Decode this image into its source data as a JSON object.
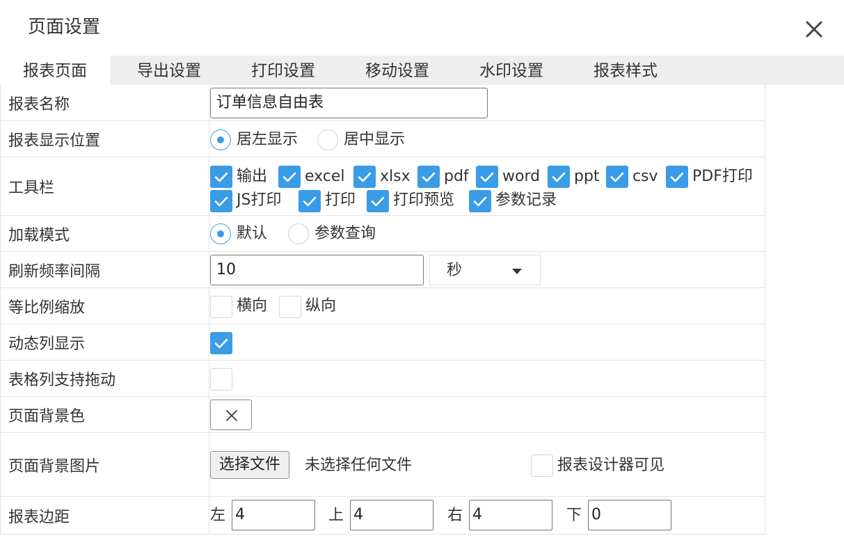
{
  "dialog": {
    "title": "页面设置",
    "close_icon": "close-icon"
  },
  "tabs": [
    "报表页面",
    "导出设置",
    "打印设置",
    "移动设置",
    "水印设置",
    "报表样式"
  ],
  "active_tab": 0,
  "accent_color": "#3a9ce6",
  "form": {
    "report_name": {
      "label": "报表名称",
      "value": "订单信息自由表"
    },
    "display_position": {
      "label": "报表显示位置",
      "options": [
        "居左显示",
        "居中显示"
      ],
      "selected": 0
    },
    "toolbar": {
      "label": "工具栏",
      "items": [
        {
          "label": "输出",
          "checked": true
        },
        {
          "label": "excel",
          "checked": true
        },
        {
          "label": "xlsx",
          "checked": true
        },
        {
          "label": "pdf",
          "checked": true
        },
        {
          "label": "word",
          "checked": true
        },
        {
          "label": "ppt",
          "checked": true
        },
        {
          "label": "csv",
          "checked": true
        },
        {
          "label": "PDF打印",
          "checked": true
        },
        {
          "label": "JS打印",
          "checked": true
        },
        {
          "label": "打印",
          "checked": true
        },
        {
          "label": "打印预览",
          "checked": true
        },
        {
          "label": "参数记录",
          "checked": true
        }
      ]
    },
    "load_mode": {
      "label": "加载模式",
      "options": [
        "默认",
        "参数查询"
      ],
      "selected": 0
    },
    "refresh_interval": {
      "label": "刷新频率间隔",
      "value": "10",
      "unit": "秒"
    },
    "proportional_scale": {
      "label": "等比例缩放",
      "options": [
        {
          "label": "横向",
          "checked": false
        },
        {
          "label": "纵向",
          "checked": false
        }
      ]
    },
    "dynamic_columns": {
      "label": "动态列显示",
      "checked": true
    },
    "column_drag": {
      "label": "表格列支持拖动",
      "checked": false
    },
    "bg_color": {
      "label": "页面背景色",
      "icon": "clear-color-icon"
    },
    "bg_image": {
      "label": "页面背景图片",
      "button": "选择文件",
      "status": "未选择任何文件",
      "designer_visible": {
        "label": "报表设计器可见",
        "checked": false
      }
    },
    "margins": {
      "label": "报表边距",
      "left": {
        "label": "左",
        "value": "4"
      },
      "top": {
        "label": "上",
        "value": "4"
      },
      "right": {
        "label": "右",
        "value": "4"
      },
      "bottom": {
        "label": "下",
        "value": "0"
      }
    }
  }
}
